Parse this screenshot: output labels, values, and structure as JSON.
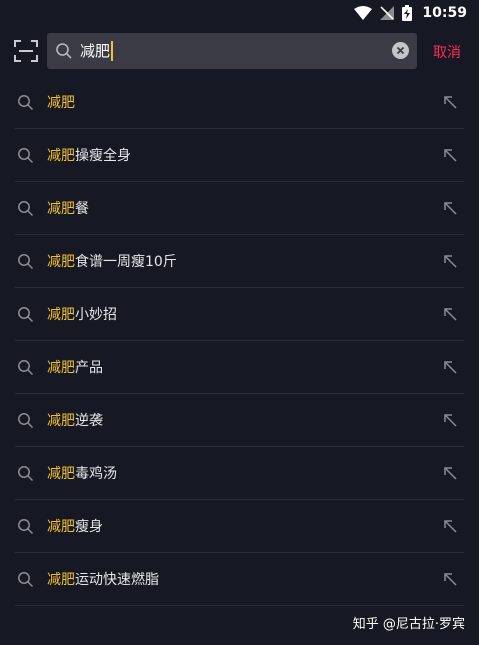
{
  "status_bar": {
    "time": "10:59"
  },
  "search": {
    "query": "减肥",
    "cancel_label": "取消"
  },
  "suggestions": [
    {
      "highlight": "减肥",
      "rest": ""
    },
    {
      "highlight": "减肥",
      "rest": "操瘦全身"
    },
    {
      "highlight": "减肥",
      "rest": "餐"
    },
    {
      "highlight": "减肥",
      "rest": "食谱一周瘦10斤"
    },
    {
      "highlight": "减肥",
      "rest": "小妙招"
    },
    {
      "highlight": "减肥",
      "rest": "产品"
    },
    {
      "highlight": "减肥",
      "rest": "逆袭"
    },
    {
      "highlight": "减肥",
      "rest": "毒鸡汤"
    },
    {
      "highlight": "减肥",
      "rest": "瘦身"
    },
    {
      "highlight": "减肥",
      "rest": "运动快速燃脂"
    }
  ],
  "watermark": "知乎 @尼古拉·罗宾",
  "colors": {
    "background": "#161823",
    "highlight": "#f2c12e",
    "cancel": "#fe2c55",
    "search_box": "#3a3b45"
  }
}
